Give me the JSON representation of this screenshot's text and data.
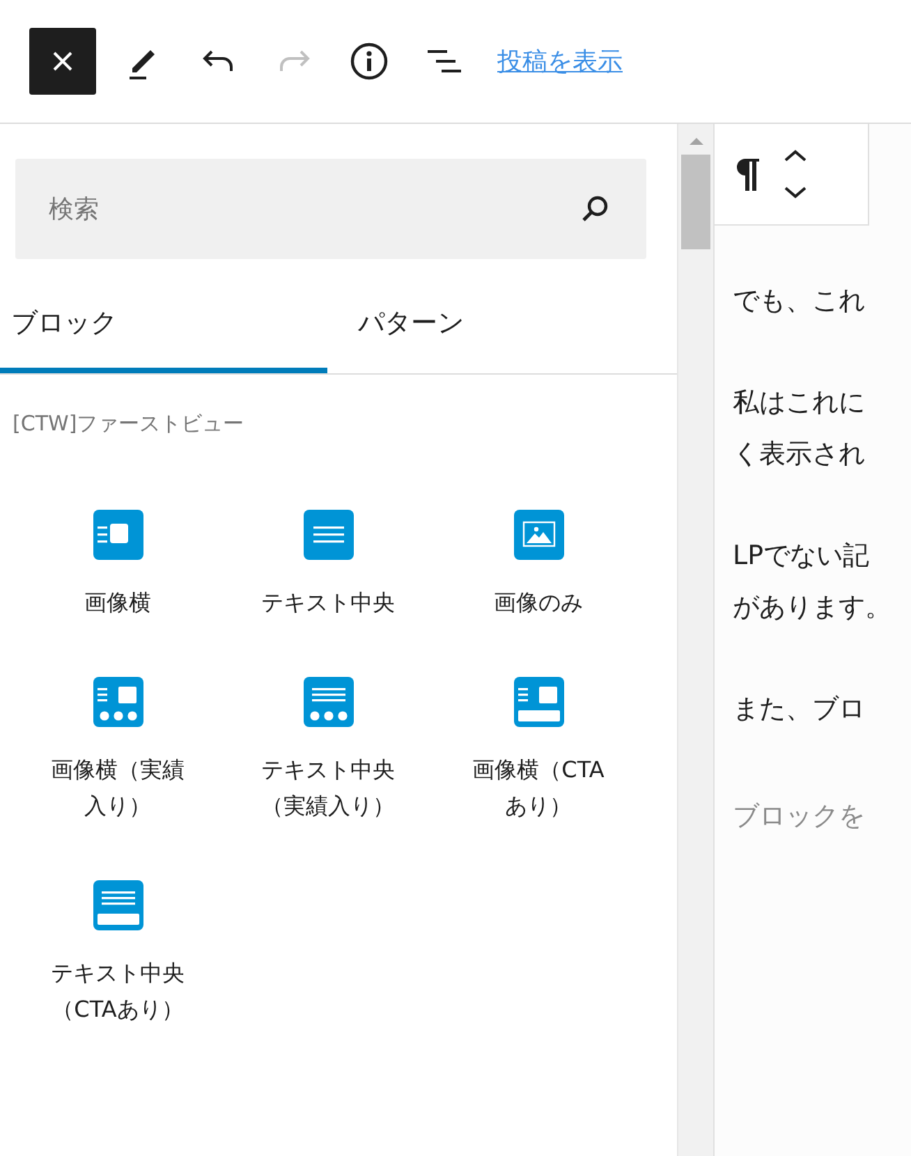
{
  "toolbar": {
    "view_post_link": "投稿を表示",
    "redo_disabled": true
  },
  "search": {
    "placeholder": "検索"
  },
  "tabs": [
    {
      "label": "ブロック",
      "selected": true
    },
    {
      "label": "パターン",
      "selected": false
    }
  ],
  "category": "[CTW]ファーストビュー",
  "blocks": [
    {
      "label": "画像横",
      "kind": "image-side"
    },
    {
      "label": "テキスト中央",
      "kind": "text-center"
    },
    {
      "label": "画像のみ",
      "kind": "image-only"
    },
    {
      "label": "画像横（実績入り）",
      "kind": "image-side-stats"
    },
    {
      "label": "テキスト中央（実績入り）",
      "kind": "text-center-stats"
    },
    {
      "label": "画像横（CTAあり）",
      "kind": "image-side-cta"
    },
    {
      "label": "テキスト中央（CTAあり）",
      "kind": "text-center-cta"
    }
  ],
  "editor": {
    "paragraphs": [
      [
        "でも、これ"
      ],
      [
        "私はこれに",
        "く表示され"
      ],
      [
        "LPでない記",
        "があります。"
      ],
      [
        "また、ブロ"
      ]
    ],
    "placeholder": "ブロックを"
  }
}
